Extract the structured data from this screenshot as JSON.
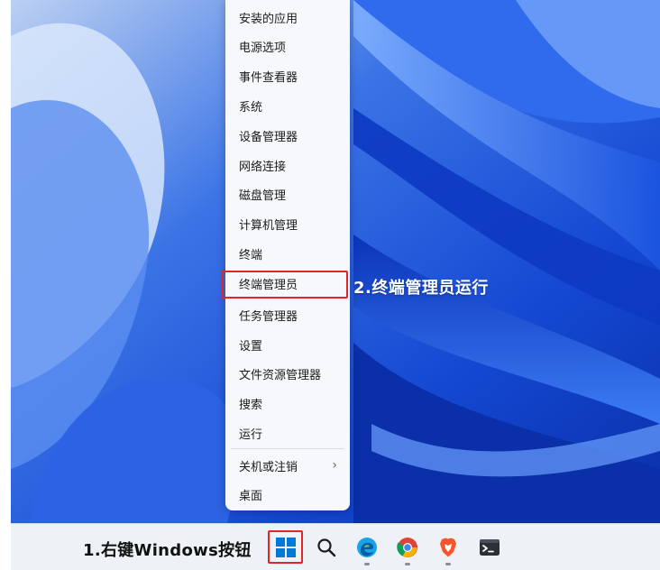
{
  "menu": {
    "items": [
      {
        "label": "安装的应用"
      },
      {
        "label": "电源选项"
      },
      {
        "label": "事件查看器"
      },
      {
        "label": "系统"
      },
      {
        "label": "设备管理器"
      },
      {
        "label": "网络连接"
      },
      {
        "label": "磁盘管理"
      },
      {
        "label": "计算机管理"
      },
      {
        "label": "终端"
      },
      {
        "label": "终端管理员"
      },
      {
        "label": "任务管理器"
      },
      {
        "label": "设置"
      },
      {
        "label": "文件资源管理器"
      },
      {
        "label": "搜索"
      },
      {
        "label": "运行"
      },
      {
        "label": "关机或注销",
        "chevron": "›"
      },
      {
        "label": "桌面"
      }
    ]
  },
  "annotations": {
    "step1": "1.右键Windows按钮",
    "step2": "2.终端管理员运行"
  },
  "taskbar": {
    "icons": [
      "windows-start-icon",
      "search-icon",
      "edge-browser-icon",
      "chrome-browser-icon",
      "brave-browser-icon",
      "terminal-icon"
    ]
  },
  "colors": {
    "highlight_box": "#e0262b",
    "wallpaper_blue": "#1a4fd6",
    "windows_blue": "#0078d4"
  }
}
